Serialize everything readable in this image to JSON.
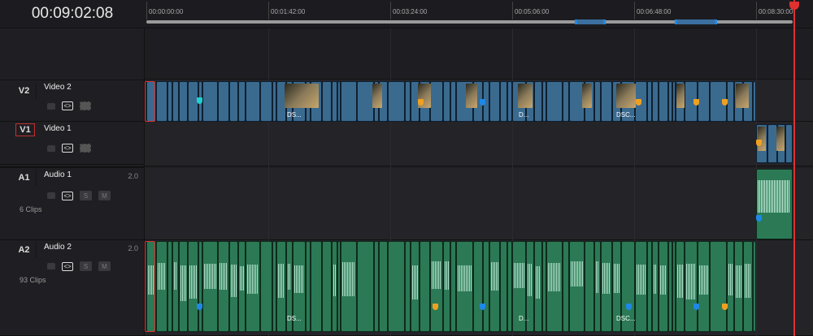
{
  "timecode": "00:09:02:08",
  "ruler": {
    "ticks": [
      "00:00:00:00",
      "00:01:42:00",
      "00:03:24:00",
      "00:05:06:00",
      "00:06:48:00",
      "00:08:30:00"
    ]
  },
  "tracks": [
    {
      "id": "V2",
      "name": "Video 2",
      "selected": false
    },
    {
      "id": "V1",
      "name": "Video 1",
      "selected": true
    },
    {
      "id": "A1",
      "name": "Audio 1",
      "format": "2.0",
      "solo": "S",
      "mute": "M",
      "clips": "6 Clips"
    },
    {
      "id": "A2",
      "name": "Audio 2",
      "format": "2.0",
      "solo": "S",
      "mute": "M",
      "clips": "93 Clips"
    }
  ],
  "clip_labels": [
    "DS...",
    "D...",
    "DSC..."
  ],
  "colors": {
    "video": "#3b6a8f",
    "audio": "#2b7a55",
    "playhead": "#e03030",
    "marker_blue": "#1e88e5",
    "marker_orange": "#f0a020",
    "marker_cyan": "#20d0d0"
  }
}
